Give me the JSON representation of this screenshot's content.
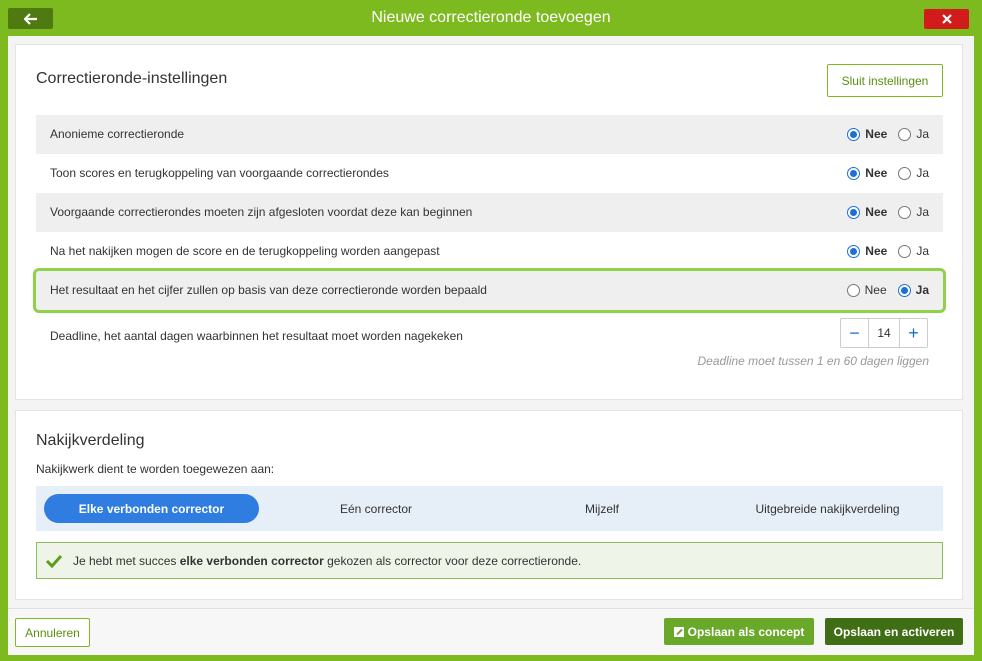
{
  "window": {
    "title": "Nieuwe correctieronde toevoegen",
    "back_icon": "arrow-left-icon",
    "close_icon": "close-icon"
  },
  "settings": {
    "title": "Correctieronde-instellingen",
    "close_button": "Sluit instellingen",
    "rows": [
      {
        "label": "Anonieme correctieronde",
        "selected": "Nee"
      },
      {
        "label": "Toon scores en terugkoppeling van voorgaande correctierondes",
        "selected": "Nee"
      },
      {
        "label": "Voorgaande correctierondes moeten zijn afgesloten voordat deze kan beginnen",
        "selected": "Nee"
      },
      {
        "label": "Na het nakijken mogen de score en de terugkoppeling worden aangepast",
        "selected": "Nee"
      },
      {
        "label": "Het resultaat en het cijfer zullen op basis van deze correctieronde worden bepaald",
        "selected": "Ja"
      }
    ],
    "option_no": "Nee",
    "option_yes": "Ja",
    "deadline": {
      "label": "Deadline, het aantal dagen waarbinnen het resultaat moet worden nagekeken",
      "minus": "−",
      "value": "14",
      "plus": "+",
      "hint": "Deadline moet tussen 1 en 60 dagen liggen"
    }
  },
  "distribution": {
    "title": "Nakijkverdeling",
    "assign_label": "Nakijkwerk dient te worden toegewezen aan:",
    "tabs": [
      {
        "label": "Elke verbonden corrector",
        "active": true
      },
      {
        "label": "Eén corrector",
        "active": false
      },
      {
        "label": "Mijzelf",
        "active": false
      },
      {
        "label": "Uitgebreide nakijkverdeling",
        "active": false
      }
    ],
    "success": {
      "prefix": "Je hebt met succes ",
      "bold": "elke verbonden corrector",
      "suffix": " gekozen als corrector voor deze correctieronde."
    }
  },
  "footer": {
    "cancel": "Annuleren",
    "save_concept": "Opslaan als concept",
    "save_activate": "Opslaan en activeren"
  },
  "colors": {
    "brand_green": "#7cba1f",
    "dark_green": "#3f6e14",
    "radio_blue": "#1a6fd8",
    "tab_blue": "#2f7de1",
    "close_red": "#d21b1b"
  }
}
